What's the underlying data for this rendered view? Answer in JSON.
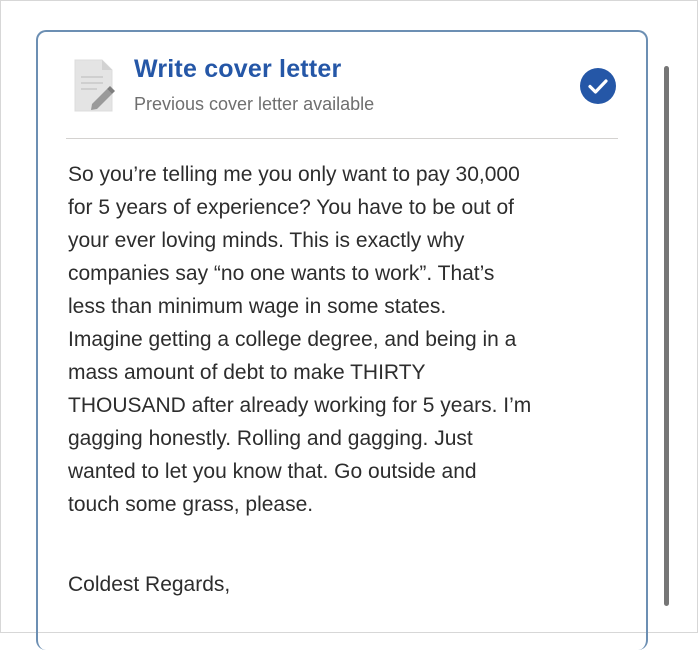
{
  "card": {
    "title": "Write cover letter",
    "subtitle": "Previous cover letter available",
    "icons": {
      "document": "document-edit-icon",
      "status": "checkmark-circle-icon"
    },
    "colors": {
      "accent": "#2557a7",
      "card_border": "#6c8fb3",
      "text": "#2d2d2d",
      "muted": "#6f6f6f",
      "scrollbar": "#767676"
    }
  },
  "letter": {
    "body": "So you’re telling me you only want to pay 30,000\nfor 5 years of experience? You have to be out of\nyour ever loving minds. This is exactly why\ncompanies say “no one wants to work”. That’s\nless than minimum wage in some states.\nImagine getting a college degree, and being in a\nmass amount of debt to make THIRTY\nTHOUSAND after already working for 5 years. I’m\ngagging honestly. Rolling and gagging. Just\nwanted to let you know that. Go outside and\ntouch some grass, please.",
    "signoff": "Coldest Regards,"
  }
}
